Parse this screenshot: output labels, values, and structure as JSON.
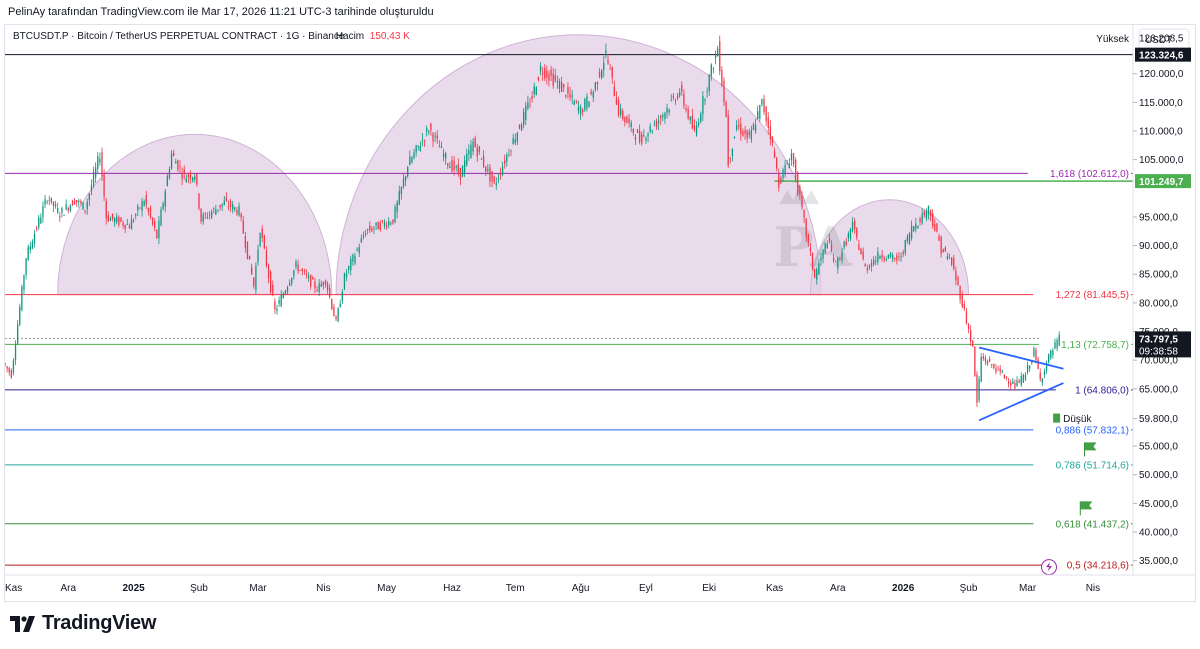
{
  "caption": "PelinAy tarafından TradingView.com ile Mar 17, 2026 11:21 UTC-3 tarihinde oluşturuldu",
  "footer": {
    "brand": "TradingView",
    "logo_icon": "tradingview-logo-icon"
  },
  "colors": {
    "up": "#089981",
    "down": "#f23645",
    "arc": "#e3cfe6",
    "arc_edge": "#cfb3d6",
    "blue": "#2962ff",
    "green_level": "#4caf50"
  },
  "chart_data": {
    "type": "candlestick",
    "symbol_line": {
      "name": "BTCUSDT.P · Bitcoin / TetherUS PERPETUAL CONTRACT · 1G · Binance",
      "volume_label": "Hacim",
      "volume_value": "150,43 K"
    },
    "currency": "USDT",
    "ylim": [
      32500,
      128500
    ],
    "y_ticks": [
      {
        "v": 120000,
        "t": "120.000,0"
      },
      {
        "v": 115000,
        "t": "115.000,0"
      },
      {
        "v": 110000,
        "t": "110.000,0"
      },
      {
        "v": 105000,
        "t": "105.000,0"
      },
      {
        "v": 95000,
        "t": "95.000,0"
      },
      {
        "v": 90000,
        "t": "90.000,0"
      },
      {
        "v": 85000,
        "t": "85.000,0"
      },
      {
        "v": 80000,
        "t": "80.000,0"
      },
      {
        "v": 75000,
        "t": "75.000,0"
      },
      {
        "v": 70000,
        "t": "70.000,0"
      },
      {
        "v": 65000,
        "t": "65.000,0"
      },
      {
        "v": 59800,
        "t": "59.800,0"
      },
      {
        "v": 55000,
        "t": "55.000,0"
      },
      {
        "v": 50000,
        "t": "50.000,0"
      },
      {
        "v": 45000,
        "t": "45.000,0"
      },
      {
        "v": 40000,
        "t": "40.000,0"
      },
      {
        "v": 35000,
        "t": "35.000,0"
      }
    ],
    "x_ticks": [
      {
        "d": "2024-11-01",
        "t": "Kas",
        "bold": false
      },
      {
        "d": "2024-12-01",
        "t": "Ara",
        "bold": false
      },
      {
        "d": "2025-01-01",
        "t": "2025",
        "bold": true
      },
      {
        "d": "2025-02-01",
        "t": "Şub",
        "bold": false
      },
      {
        "d": "2025-03-01",
        "t": "Mar",
        "bold": false
      },
      {
        "d": "2025-04-01",
        "t": "Nis",
        "bold": false
      },
      {
        "d": "2025-05-01",
        "t": "May",
        "bold": false
      },
      {
        "d": "2025-06-01",
        "t": "Haz",
        "bold": false
      },
      {
        "d": "2025-07-01",
        "t": "Tem",
        "bold": false
      },
      {
        "d": "2025-08-01",
        "t": "Ağu",
        "bold": false
      },
      {
        "d": "2025-09-01",
        "t": "Eyl",
        "bold": false
      },
      {
        "d": "2025-10-01",
        "t": "Eki",
        "bold": false
      },
      {
        "d": "2025-11-01",
        "t": "Kas",
        "bold": false
      },
      {
        "d": "2025-12-01",
        "t": "Ara",
        "bold": false
      },
      {
        "d": "2026-01-01",
        "t": "2026",
        "bold": true
      },
      {
        "d": "2026-02-01",
        "t": "Şub",
        "bold": false
      },
      {
        "d": "2026-03-01",
        "t": "Mar",
        "bold": false
      },
      {
        "d": "2026-04-01",
        "t": "Nis",
        "bold": false
      }
    ],
    "xlim": [
      "2024-11-01",
      "2026-04-20"
    ],
    "price_path": [
      [
        "2024-11-01",
        69500
      ],
      [
        "2024-11-05",
        67500
      ],
      [
        "2024-11-12",
        88000
      ],
      [
        "2024-11-22",
        98500
      ],
      [
        "2024-11-28",
        95500
      ],
      [
        "2024-12-05",
        98000
      ],
      [
        "2024-12-10",
        96500
      ],
      [
        "2024-12-17",
        106000
      ],
      [
        "2024-12-20",
        95000
      ],
      [
        "2024-12-31",
        93500
      ],
      [
        "2025-01-07",
        98000
      ],
      [
        "2025-01-13",
        91500
      ],
      [
        "2025-01-20",
        106000
      ],
      [
        "2025-01-26",
        102000
      ],
      [
        "2025-01-31",
        102500
      ],
      [
        "2025-02-03",
        94500
      ],
      [
        "2025-02-14",
        97500
      ],
      [
        "2025-02-21",
        96000
      ],
      [
        "2025-02-28",
        83000
      ],
      [
        "2025-03-03",
        93000
      ],
      [
        "2025-03-10",
        78500
      ],
      [
        "2025-03-20",
        86500
      ],
      [
        "2025-03-30",
        82500
      ],
      [
        "2025-04-03",
        84000
      ],
      [
        "2025-04-08",
        76500
      ],
      [
        "2025-04-12",
        84500
      ],
      [
        "2025-04-22",
        92500
      ],
      [
        "2025-05-05",
        94500
      ],
      [
        "2025-05-12",
        104000
      ],
      [
        "2025-05-22",
        110500
      ],
      [
        "2025-05-31",
        104500
      ],
      [
        "2025-06-06",
        102500
      ],
      [
        "2025-06-12",
        108000
      ],
      [
        "2025-06-22",
        100500
      ],
      [
        "2025-06-30",
        107500
      ],
      [
        "2025-07-10",
        116000
      ],
      [
        "2025-07-14",
        121000
      ],
      [
        "2025-07-23",
        118000
      ],
      [
        "2025-08-02",
        113500
      ],
      [
        "2025-08-08",
        117000
      ],
      [
        "2025-08-14",
        123500
      ],
      [
        "2025-08-20",
        113500
      ],
      [
        "2025-08-30",
        108500
      ],
      [
        "2025-09-07",
        111500
      ],
      [
        "2025-09-18",
        117000
      ],
      [
        "2025-09-25",
        109500
      ],
      [
        "2025-10-01",
        118000
      ],
      [
        "2025-10-06",
        124500
      ],
      [
        "2025-10-10",
        112500
      ],
      [
        "2025-10-11",
        104500
      ],
      [
        "2025-10-15",
        111000
      ],
      [
        "2025-10-21",
        108500
      ],
      [
        "2025-10-27",
        115000
      ],
      [
        "2025-10-31",
        109500
      ],
      [
        "2025-11-04",
        101000
      ],
      [
        "2025-11-10",
        106000
      ],
      [
        "2025-11-17",
        92000
      ],
      [
        "2025-11-21",
        84500
      ],
      [
        "2025-11-27",
        91000
      ],
      [
        "2025-12-01",
        86500
      ],
      [
        "2025-12-09",
        93500
      ],
      [
        "2025-12-15",
        86000
      ],
      [
        "2025-12-22",
        88500
      ],
      [
        "2025-12-31",
        87500
      ],
      [
        "2026-01-06",
        93000
      ],
      [
        "2026-01-14",
        96500
      ],
      [
        "2026-01-20",
        89500
      ],
      [
        "2026-01-25",
        87000
      ],
      [
        "2026-01-31",
        78500
      ],
      [
        "2026-02-04",
        72000
      ],
      [
        "2026-02-06",
        62500
      ],
      [
        "2026-02-08",
        70500
      ],
      [
        "2026-02-15",
        68500
      ],
      [
        "2026-02-24",
        65500
      ],
      [
        "2026-03-01",
        67500
      ],
      [
        "2026-03-05",
        71500
      ],
      [
        "2026-03-08",
        66500
      ],
      [
        "2026-03-12",
        70500
      ],
      [
        "2026-03-17",
        73797.5
      ]
    ],
    "arcs": [
      {
        "from": "2024-11-26",
        "to": "2025-04-05",
        "base": 81445.5,
        "peak": 109400
      },
      {
        "from": "2025-04-07",
        "to": "2025-11-23",
        "base": 81445.5,
        "peak": 126800
      },
      {
        "from": "2025-11-18",
        "to": "2026-02-01",
        "base": 81445.5,
        "peak": 98000
      }
    ],
    "horizontal_levels": [
      {
        "v": 123324.6,
        "color": "#131722",
        "label": ""
      },
      {
        "v": 102612.0,
        "color": "#9c27b0",
        "label": "1,618 (102.612,0)"
      },
      {
        "v": 101249.7,
        "color": "#4caf50",
        "label": "",
        "from": "2025-11-01"
      },
      {
        "v": 81445.5,
        "color": "#f23645",
        "label": "1,272 (81.445,5)"
      },
      {
        "v": 73797.5,
        "color": "#9598a1",
        "label": "",
        "dashed": true
      },
      {
        "v": 72758.7,
        "color": "#4caf50",
        "label": "1,13 (72.758,7)"
      },
      {
        "v": 64806.0,
        "color": "#311b92",
        "label": "1 (64.806,0)"
      },
      {
        "v": 57832.1,
        "color": "#2962ff",
        "label": "0,886 (57.832,1)"
      },
      {
        "v": 51714.6,
        "color": "#26a69a",
        "label": "0,786 (51.714,6)"
      },
      {
        "v": 41437.2,
        "color": "#388e3c",
        "label": "0,618 (41.437,2)"
      },
      {
        "v": 34218.6,
        "color": "#b71c1c",
        "label": "0,5 (34.218,6)"
      }
    ],
    "triangle": [
      {
        "from": [
          "2026-02-06",
          72200
        ],
        "to": [
          "2026-03-18",
          68500
        ]
      },
      {
        "from": [
          "2026-02-06",
          59500
        ],
        "to": [
          "2026-03-18",
          66000
        ]
      }
    ],
    "flags": [
      {
        "d": "2026-03-28",
        "v": 54600
      },
      {
        "d": "2026-03-26",
        "v": 44300
      }
    ],
    "markers": {
      "high": {
        "label": "Yüksek",
        "value": "126.208,5",
        "v": 126208.5
      },
      "low": {
        "label": "Düşük",
        "value": "59.800,0",
        "v": 59800,
        "d": "2026-03-15"
      }
    },
    "price_badges": [
      {
        "v": 123324.6,
        "t": "123.324,6",
        "bg": "#131722"
      },
      {
        "v": 101249.7,
        "t": "101.249,7",
        "bg": "#4caf50"
      },
      {
        "v": 73797.5,
        "t": "73.797,5",
        "bg": "#131722",
        "sub": "09:38:58"
      }
    ],
    "watermark": "PA"
  }
}
